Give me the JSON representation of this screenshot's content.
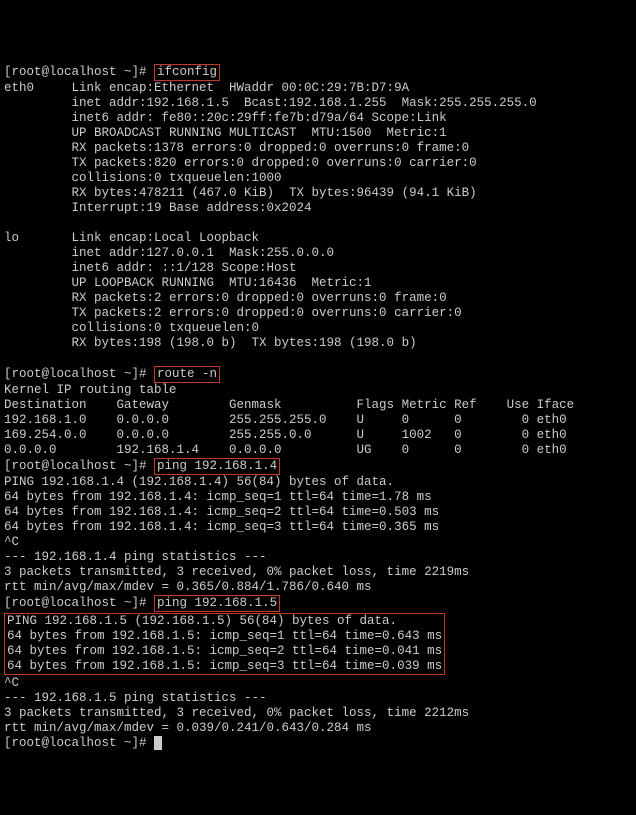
{
  "prompt": "[root@localhost ~]#",
  "cmd_ifconfig": "ifconfig",
  "eth0": {
    "l1": "eth0     Link encap:Ethernet  HWaddr 00:0C:29:7B:D7:9A",
    "l2": "         inet addr:192.168.1.5  Bcast:192.168.1.255  Mask:255.255.255.0",
    "l3": "         inet6 addr: fe80::20c:29ff:fe7b:d79a/64 Scope:Link",
    "l4": "         UP BROADCAST RUNNING MULTICAST  MTU:1500  Metric:1",
    "l5": "         RX packets:1378 errors:0 dropped:0 overruns:0 frame:0",
    "l6": "         TX packets:820 errors:0 dropped:0 overruns:0 carrier:0",
    "l7": "         collisions:0 txqueuelen:1000",
    "l8": "         RX bytes:478211 (467.0 KiB)  TX bytes:96439 (94.1 KiB)",
    "l9": "         Interrupt:19 Base address:0x2024"
  },
  "lo": {
    "l1": "lo       Link encap:Local Loopback",
    "l2": "         inet addr:127.0.0.1  Mask:255.0.0.0",
    "l3": "         inet6 addr: ::1/128 Scope:Host",
    "l4": "         UP LOOPBACK RUNNING  MTU:16436  Metric:1",
    "l5": "         RX packets:2 errors:0 dropped:0 overruns:0 frame:0",
    "l6": "         TX packets:2 errors:0 dropped:0 overruns:0 carrier:0",
    "l7": "         collisions:0 txqueuelen:0",
    "l8": "         RX bytes:198 (198.0 b)  TX bytes:198 (198.0 b)"
  },
  "cmd_route": "route -n",
  "route": {
    "l1": "Kernel IP routing table",
    "l2": "Destination    Gateway        Genmask          Flags Metric Ref    Use Iface",
    "l3": "192.168.1.0    0.0.0.0        255.255.255.0    U     0      0        0 eth0",
    "l4": "169.254.0.0    0.0.0.0        255.255.0.0      U     1002   0        0 eth0",
    "l5": "0.0.0.0        192.168.1.4    0.0.0.0          UG    0      0        0 eth0"
  },
  "cmd_ping1": "ping 192.168.1.4",
  "ping1": {
    "l1": "PING 192.168.1.4 (192.168.1.4) 56(84) bytes of data.",
    "l2": "64 bytes from 192.168.1.4: icmp_seq=1 ttl=64 time=1.78 ms",
    "l3": "64 bytes from 192.168.1.4: icmp_seq=2 ttl=64 time=0.503 ms",
    "l4": "64 bytes from 192.168.1.4: icmp_seq=3 ttl=64 time=0.365 ms",
    "l5": "^C",
    "l6": "--- 192.168.1.4 ping statistics ---",
    "l7": "3 packets transmitted, 3 received, 0% packet loss, time 2219ms",
    "l8": "rtt min/avg/max/mdev = 0.365/0.884/1.786/0.640 ms"
  },
  "cmd_ping2": "ping 192.168.1.5",
  "ping2": {
    "l1": "PING 192.168.1.5 (192.168.1.5) 56(84) bytes of data.",
    "l2": "64 bytes from 192.168.1.5: icmp_seq=1 ttl=64 time=0.643 ms",
    "l3": "64 bytes from 192.168.1.5: icmp_seq=2 ttl=64 time=0.041 ms",
    "l4": "64 bytes from 192.168.1.5: icmp_seq=3 ttl=64 time=0.039 ms",
    "l5": "^C",
    "l6": "--- 192.168.1.5 ping statistics ---",
    "l7": "3 packets transmitted, 3 received, 0% packet loss, time 2212ms",
    "l8": "rtt min/avg/max/mdev = 0.039/0.241/0.643/0.284 ms"
  }
}
